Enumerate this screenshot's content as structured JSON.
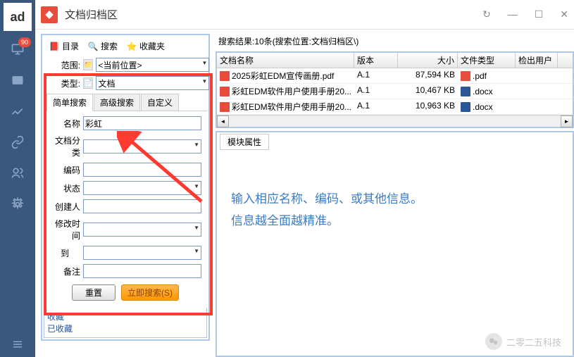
{
  "sidebar": {
    "logo": "ad",
    "badge": "90"
  },
  "titlebar": {
    "title": "文档归档区"
  },
  "toolbar": {
    "catalog": "目录",
    "search": "搜索",
    "favorites": "收藏夹"
  },
  "scope_form": {
    "scope_label": "范围:",
    "scope_value": "<当前位置>",
    "type_label": "类型:",
    "type_value": "文档"
  },
  "tabs": {
    "simple": "简单搜索",
    "advanced": "高级搜索",
    "custom": "自定义"
  },
  "search_form": {
    "name_label": "名称",
    "name_value": "彩虹",
    "category_label": "文档分类",
    "code_label": "编码",
    "status_label": "状态",
    "creator_label": "创建人",
    "modtime_label": "修改时间",
    "to_label": "到",
    "remark_label": "备注",
    "reset_btn": "重置",
    "search_btn": "立即搜索(S)"
  },
  "left_bottom": {
    "favorites": "收藏",
    "favorited": "已收藏"
  },
  "results": {
    "header": "搜索结果:10条(搜索位置:文档归档区\\)",
    "cols": {
      "name": "文档名称",
      "version": "版本",
      "size": "大小",
      "filetype": "文件类型",
      "user": "检出用户"
    },
    "rows": [
      {
        "name": "2025彩虹EDM宣传画册.pdf",
        "version": "A.1",
        "size": "87,594 KB",
        "type": ".pdf",
        "type_class": "pdf"
      },
      {
        "name": "彩虹EDM软件用户使用手册20...",
        "version": "A.1",
        "size": "10,467 KB",
        "type": ".docx",
        "type_class": "docx"
      },
      {
        "name": "彩虹EDM软件用户使用手册20...",
        "version": "A.1",
        "size": "10,963 KB",
        "type": ".docx",
        "type_class": "docx"
      }
    ]
  },
  "props": {
    "tab": "模块属性"
  },
  "hint": {
    "line1": "输入相应名称、编码、或其他信息。",
    "line2": "信息越全面越精准。"
  },
  "watermark": "二零二五科技"
}
